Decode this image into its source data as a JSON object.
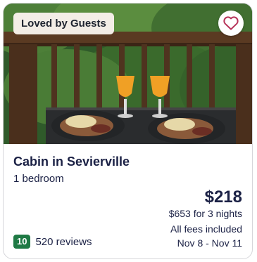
{
  "listing": {
    "badge": "Loved by Guests",
    "title": "Cabin in Sevierville",
    "subtitle": "1 bedroom",
    "price": "$218",
    "total": "$653 for 3 nights",
    "fees_note": "All fees included",
    "dates": "Nov 8 - Nov 11",
    "rating_score": "10",
    "reviews": "520 reviews",
    "favorite_icon": "heart-icon",
    "colors": {
      "text": "#1b2145",
      "rating_badge": "#1f7a45",
      "heart": "#b8365c",
      "badge_bg": "#f3ede6"
    }
  }
}
